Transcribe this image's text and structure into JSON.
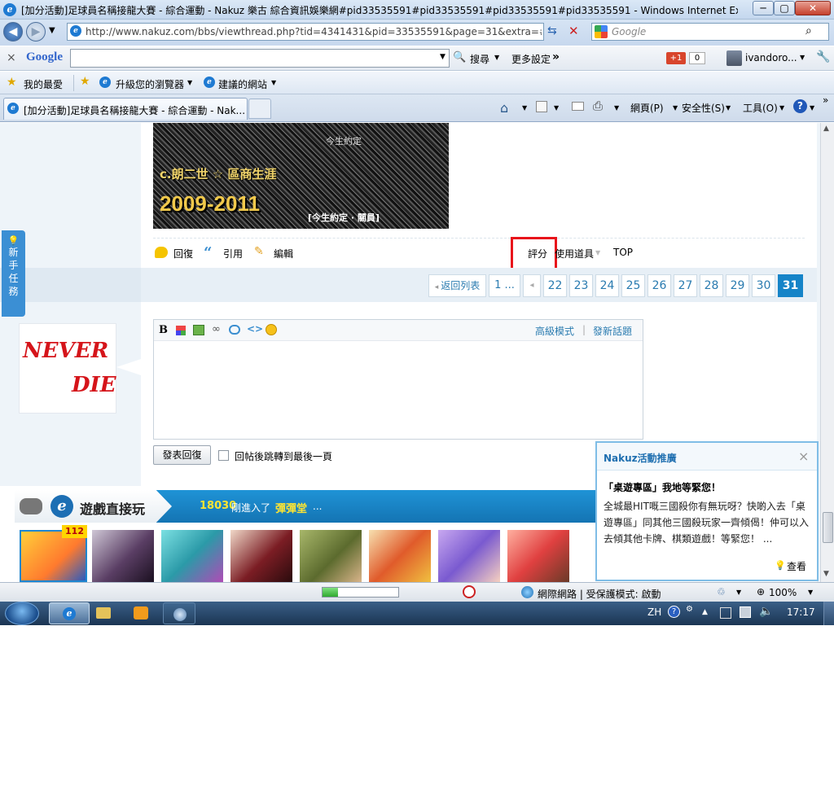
{
  "window": {
    "title": "[加分活動]足球員名稱接龍大賽 - 綜合運動 - Nakuz 樂古 綜合資訊娛樂網#pid33535591#pid33535591#pid33535591#pid33535591 - Windows Internet Explorer",
    "minimize": "─",
    "maximize": "▢",
    "close": "✕"
  },
  "address": {
    "url": "http://www.nakuz.com/bbs/viewthread.php?tid=4341431&pid=33535591&page=31&extra=#p",
    "search_placeholder": "Google"
  },
  "google_bar": {
    "close": "×",
    "logo": "Google",
    "search_label": "搜尋",
    "more_settings": "更多設定",
    "more_arrow": "»",
    "plus_one": "+1",
    "count": "0",
    "user": "ivandoro..."
  },
  "favorites_bar": {
    "favorites": "我的最愛",
    "upgrade": "升級您的瀏覽器",
    "suggested": "建議的網站"
  },
  "tab": {
    "label": "[加分活動]足球員名稱接龍大賽 - 綜合運動 - Nak...",
    "overflow": "»"
  },
  "command_bar": {
    "page": "網頁(P)",
    "safety": "安全性(S)",
    "tools": "工具(O)",
    "help": "?"
  },
  "sidebar_task": [
    "新",
    "手",
    "任",
    "務"
  ],
  "avatar": {
    "line1": "NEVER",
    "line2": "DIE"
  },
  "signature": {
    "line1": "c.朗二世 ☆ 區商生涯",
    "year": "2009-2011",
    "tag": "[今生約定 · 關員]",
    "overlay": "今生約定"
  },
  "post_actions": {
    "reply": "回復",
    "quote": "引用",
    "edit": "編輯",
    "rate": "評分",
    "use_tools": "使用道具",
    "top": "TOP"
  },
  "pagination": {
    "back": "返回列表",
    "first": "1 ...",
    "pages": [
      "22",
      "23",
      "24",
      "25",
      "26",
      "27",
      "28",
      "29",
      "30"
    ],
    "current": "31"
  },
  "editor": {
    "advanced": "高級模式",
    "separator": "|",
    "new_topic": "發新話題",
    "submit": "發表回復",
    "jump_label": "回帖後跳轉到最後一頁"
  },
  "games": {
    "title": "遊戲直接玩",
    "count": "18030",
    "entered": "剛進入了",
    "game_name": "彈彈堂",
    "ellipsis": "...",
    "badge": "112"
  },
  "promo": {
    "title": "Nakuz活動推廣",
    "close": "×",
    "headline": "「桌遊專區」我地等緊您！",
    "body": "全城最HIT嘅三國殺你有無玩呀？快啲入去「桌遊專區」同其他三國殺玩家一齊傾偈！仲可以入去傾其他卡牌、棋類遊戲！等緊您！ ...",
    "view": "查看"
  },
  "status_bar": {
    "zone": "網際網路 | 受保護模式: 啟動",
    "zoom": "100%"
  },
  "taskbar": {
    "lang": "ZH",
    "clock": "17:17"
  }
}
